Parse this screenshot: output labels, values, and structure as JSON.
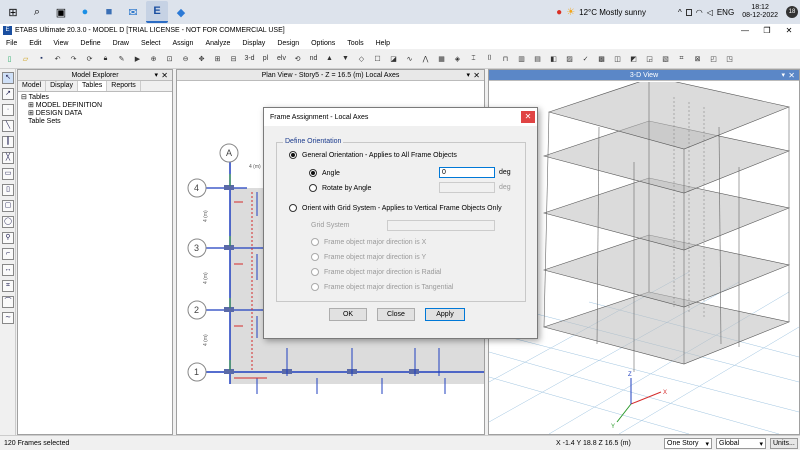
{
  "taskbar": {
    "start": "⊞",
    "search": "⌕",
    "apps": [
      "▣",
      "●",
      "■",
      "✉",
      "E",
      "◆"
    ],
    "tray": {
      "chrome": "●",
      "weather_icon": "☀",
      "weather": "12°C  Mostly sunny",
      "chevron": "^",
      "language": "ENG",
      "time": "18:12",
      "date": "08-12-2022",
      "notif_count": "18"
    }
  },
  "app": {
    "title": "ETABS Ultimate 20.3.0 - MODEL D  [TRIAL LICENSE - NOT FOR COMMERCIAL USE]",
    "minimize": "—",
    "maximize": "❐",
    "close": "✕"
  },
  "menu": [
    "File",
    "Edit",
    "View",
    "Define",
    "Draw",
    "Select",
    "Assign",
    "Analyze",
    "Display",
    "Design",
    "Options",
    "Tools",
    "Help"
  ],
  "toolbar": {
    "label_3d": "3-d",
    "label_pl": "pl",
    "label_elv": "elv",
    "label_nd": "nd"
  },
  "explorer": {
    "title": "Model Explorer",
    "pin": "▾",
    "close": "✕",
    "tabs": [
      "Model",
      "Display",
      "Tables",
      "Reports"
    ],
    "tree": [
      "⊟ Tables",
      "⊞ MODEL DEFINITION",
      "⊞ DESIGN DATA",
      "Table Sets"
    ]
  },
  "planview": {
    "title": "Plan View - Story5 - Z = 16.5 (m)  Local Axes",
    "grid_col": "A",
    "grid_rows": [
      "4",
      "3",
      "2",
      "1"
    ],
    "dim_label": "4 (m)"
  },
  "view3d": {
    "title": "3-D View",
    "axis_x": "X",
    "axis_y": "Y",
    "axis_z": "Z"
  },
  "dialog": {
    "title": "Frame Assignment - Local Axes",
    "close": "✕",
    "group_title": "Define Orientation",
    "general": "General Orientation - Applies to All Frame Objects",
    "angle_label": "Angle",
    "angle_value": "0",
    "angle_unit": "deg",
    "rotate_label": "Rotate by Angle",
    "rotate_unit": "deg",
    "grid_option": "Orient with Grid System - Applies to Vertical Frame Objects Only",
    "grid_system_label": "Grid System",
    "major_x": "Frame object major direction is X",
    "major_y": "Frame object major direction is Y",
    "major_radial": "Frame object major direction is Radial",
    "major_tangential": "Frame object major direction is Tangential",
    "ok": "OK",
    "close_btn": "Close",
    "apply": "Apply"
  },
  "status": {
    "selection": "120 Frames selected",
    "coords": "X -1.4  Y 18.8  Z 16.5 (m)",
    "story": "One Story",
    "coord_sys": "Global",
    "units": "Units..."
  },
  "colors": {
    "accent": "#0078d7",
    "close_red": "#e04343",
    "frame_blue": "#1f3fbf",
    "beam_red": "#d42a2a"
  }
}
